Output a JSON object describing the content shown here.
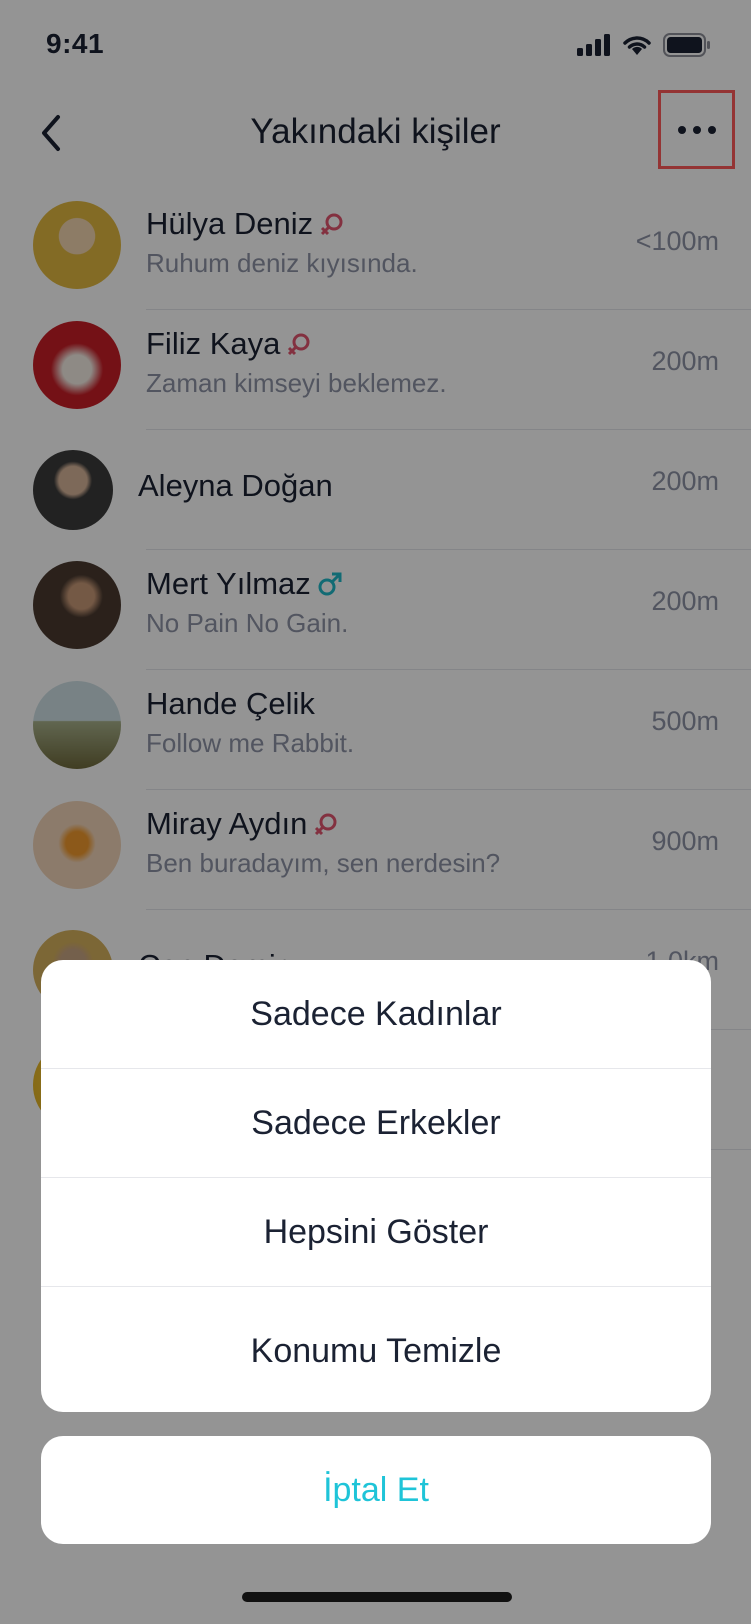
{
  "status_bar": {
    "time": "9:41"
  },
  "nav": {
    "title": "Yakındaki kişiler"
  },
  "people": [
    {
      "name": "Hülya Deniz",
      "status": "Ruhum deniz kıyısında.",
      "distance": "<100m",
      "gender": "female"
    },
    {
      "name": "Filiz Kaya",
      "status": "Zaman kimseyi beklemez.",
      "distance": "200m",
      "gender": "female"
    },
    {
      "name": "Aleyna Doğan",
      "status": "",
      "distance": "200m",
      "gender": ""
    },
    {
      "name": "Mert Yılmaz",
      "status": "No Pain No Gain.",
      "distance": "200m",
      "gender": "male"
    },
    {
      "name": "Hande Çelik",
      "status": "Follow me Rabbit.",
      "distance": "500m",
      "gender": ""
    },
    {
      "name": "Miray Aydın",
      "status": "Ben buradayım, sen nerdesin?",
      "distance": "900m",
      "gender": "female"
    },
    {
      "name": "Can Demir",
      "status": "",
      "distance": "1.0km",
      "gender": ""
    },
    {
      "name": "",
      "status": "",
      "distance": "",
      "gender": ""
    }
  ],
  "action_sheet": {
    "options": [
      "Sadece Kadınlar",
      "Sadece Erkekler",
      "Hepsini Göster",
      "Konumu Temizle"
    ],
    "cancel": "İptal Et"
  },
  "colors": {
    "female": "#e2556f",
    "male": "#1fb8c9",
    "accent": "#1fc4d8",
    "highlight": "#ff5a5a",
    "text": "#1b2233",
    "secondary": "#8d93a5"
  }
}
